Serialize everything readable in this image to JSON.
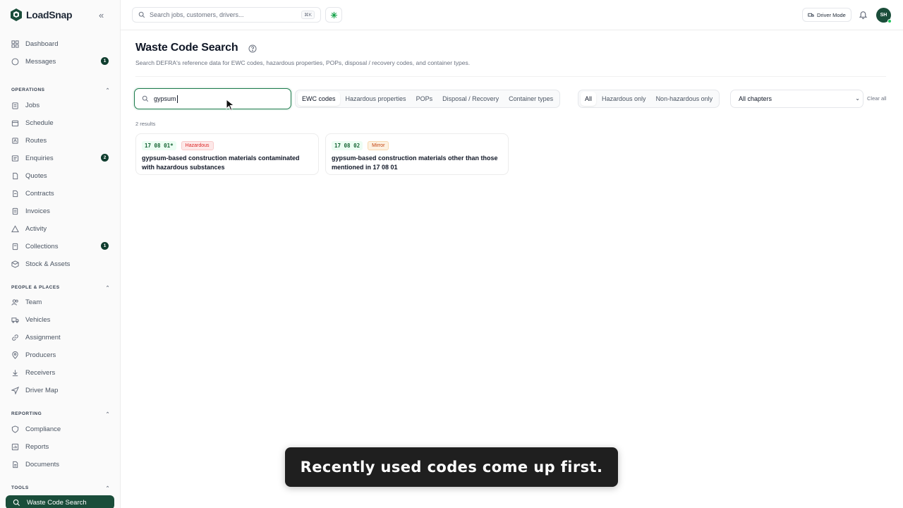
{
  "app": {
    "name": "LoadSnap"
  },
  "sidebar": {
    "top_items": [
      {
        "label": "Dashboard",
        "icon": "grid-icon"
      },
      {
        "label": "Messages",
        "icon": "chat-icon",
        "badge": "1"
      }
    ],
    "sections": [
      {
        "label": "OPERATIONS",
        "items": [
          {
            "label": "Jobs"
          },
          {
            "label": "Schedule"
          },
          {
            "label": "Routes"
          },
          {
            "label": "Enquiries",
            "badge": "2"
          },
          {
            "label": "Quotes"
          },
          {
            "label": "Contracts"
          },
          {
            "label": "Invoices"
          },
          {
            "label": "Activity"
          },
          {
            "label": "Collections",
            "badge": "1"
          },
          {
            "label": "Stock & Assets"
          }
        ]
      },
      {
        "label": "PEOPLE & PLACES",
        "items": [
          {
            "label": "Team"
          },
          {
            "label": "Vehicles"
          },
          {
            "label": "Assignment"
          },
          {
            "label": "Producers"
          },
          {
            "label": "Receivers"
          },
          {
            "label": "Driver Map"
          }
        ]
      },
      {
        "label": "REPORTING",
        "items": [
          {
            "label": "Compliance"
          },
          {
            "label": "Reports"
          },
          {
            "label": "Documents"
          }
        ]
      },
      {
        "label": "TOOLS",
        "items": [
          {
            "label": "Waste Code Search",
            "active": true
          }
        ]
      }
    ]
  },
  "topbar": {
    "search_placeholder": "Search jobs, customers, drivers...",
    "shortcut": "⌘K",
    "driver_mode": "Driver Mode",
    "avatar_initials": "SH"
  },
  "page": {
    "title": "Waste Code Search",
    "subtitle": "Search DEFRA's reference data for EWC codes, hazardous properties, POPs, disposal / recovery codes, and container types.",
    "search_value": "gypsum",
    "type_tabs": [
      "EWC codes",
      "Hazardous properties",
      "POPs",
      "Disposal / Recovery",
      "Container types"
    ],
    "active_type_tab": "EWC codes",
    "hazard_filters": [
      "All",
      "Hazardous only",
      "Non-hazardous only"
    ],
    "active_hazard_filter": "All",
    "chapter_select": "All chapters",
    "clear_all": "Clear all",
    "result_count": "2 results",
    "results": [
      {
        "code": "17 08 01*",
        "tag": "Hazardous",
        "description": "gypsum-based construction materials contaminated with hazardous substances"
      },
      {
        "code": "17 08 02",
        "tag": "Mirror",
        "description": "gypsum-based construction materials other than those mentioned in 17 08 01"
      }
    ]
  },
  "caption": "Recently used codes come up first.",
  "colors": {
    "brand": "#1a4d3a",
    "accent": "#1a7a4a",
    "hazard": "#dc2626",
    "mirror": "#c2410c"
  }
}
